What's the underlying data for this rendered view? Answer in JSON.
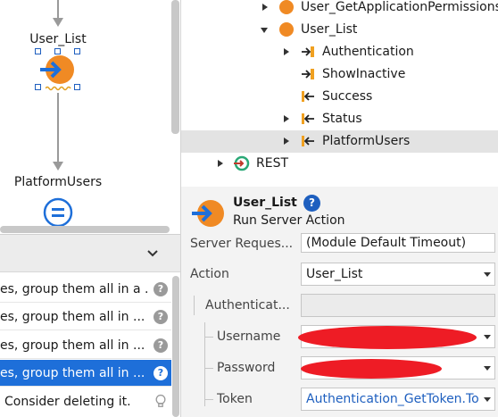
{
  "canvas": {
    "node_top_label": "User_List",
    "node_bottom_label": "PlatformUsers"
  },
  "truechange": {
    "rows": [
      {
        "text": "es, group them all in a ...",
        "icon": "help-icon",
        "selected": false
      },
      {
        "text": "es, group them all in ...",
        "icon": "help-icon",
        "selected": false
      },
      {
        "text": "es, group them all in ...",
        "icon": "help-icon",
        "selected": false
      },
      {
        "text": "es, group them all in ...",
        "icon": "help-icon",
        "selected": true
      },
      {
        "text": "Consider deleting it.",
        "icon": "lightbulb-icon",
        "selected": false
      }
    ]
  },
  "tree": {
    "items": [
      {
        "label": "User_GetApplicationPermissions",
        "icon": "server-action-icon",
        "expander": "collapsed"
      },
      {
        "label": "User_List",
        "icon": "server-action-icon",
        "expander": "expanded"
      },
      {
        "label": "Authentication",
        "icon": "input-parameter-icon",
        "expander": "collapsed"
      },
      {
        "label": "ShowInactive",
        "icon": "input-parameter-icon",
        "expander": "none"
      },
      {
        "label": "Success",
        "icon": "output-parameter-icon",
        "expander": "none"
      },
      {
        "label": "Status",
        "icon": "output-parameter-icon",
        "expander": "collapsed"
      },
      {
        "label": "PlatformUsers",
        "icon": "output-parameter-icon",
        "expander": "collapsed",
        "selected": true
      },
      {
        "label": "REST",
        "icon": "rest-icon",
        "expander": "collapsed"
      }
    ]
  },
  "properties": {
    "title": "User_List",
    "subtitle": "Run Server Action",
    "help_glyph": "?",
    "fields": {
      "server_request_label": "Server Reques...",
      "server_request_value": "(Module Default Timeout)",
      "action_label": "Action",
      "action_value": "User_List",
      "authentication_label": "Authenticat...",
      "authentication_value": "",
      "username_label": "Username",
      "username_value": "",
      "password_label": "Password",
      "password_value": "",
      "token_label": "Token",
      "token_value": "Authentication_GetToken.To"
    }
  },
  "colors": {
    "accent": "#1e6fd9",
    "orange": "#f08a24",
    "redaction": "#ee1c25",
    "link": "#1e5fbf"
  }
}
